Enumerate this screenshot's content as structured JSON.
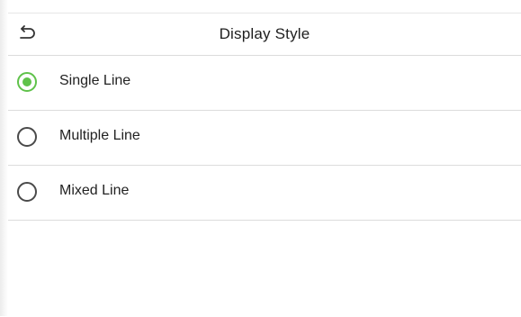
{
  "header": {
    "title": "Display Style",
    "back_icon": "back-arrow-icon"
  },
  "options": [
    {
      "label": "Single Line",
      "selected": true
    },
    {
      "label": "Multiple Line",
      "selected": false
    },
    {
      "label": "Mixed Line",
      "selected": false
    }
  ],
  "colors": {
    "accent": "#5fc24a",
    "divider": "#dcdcdc",
    "text": "#222222"
  }
}
